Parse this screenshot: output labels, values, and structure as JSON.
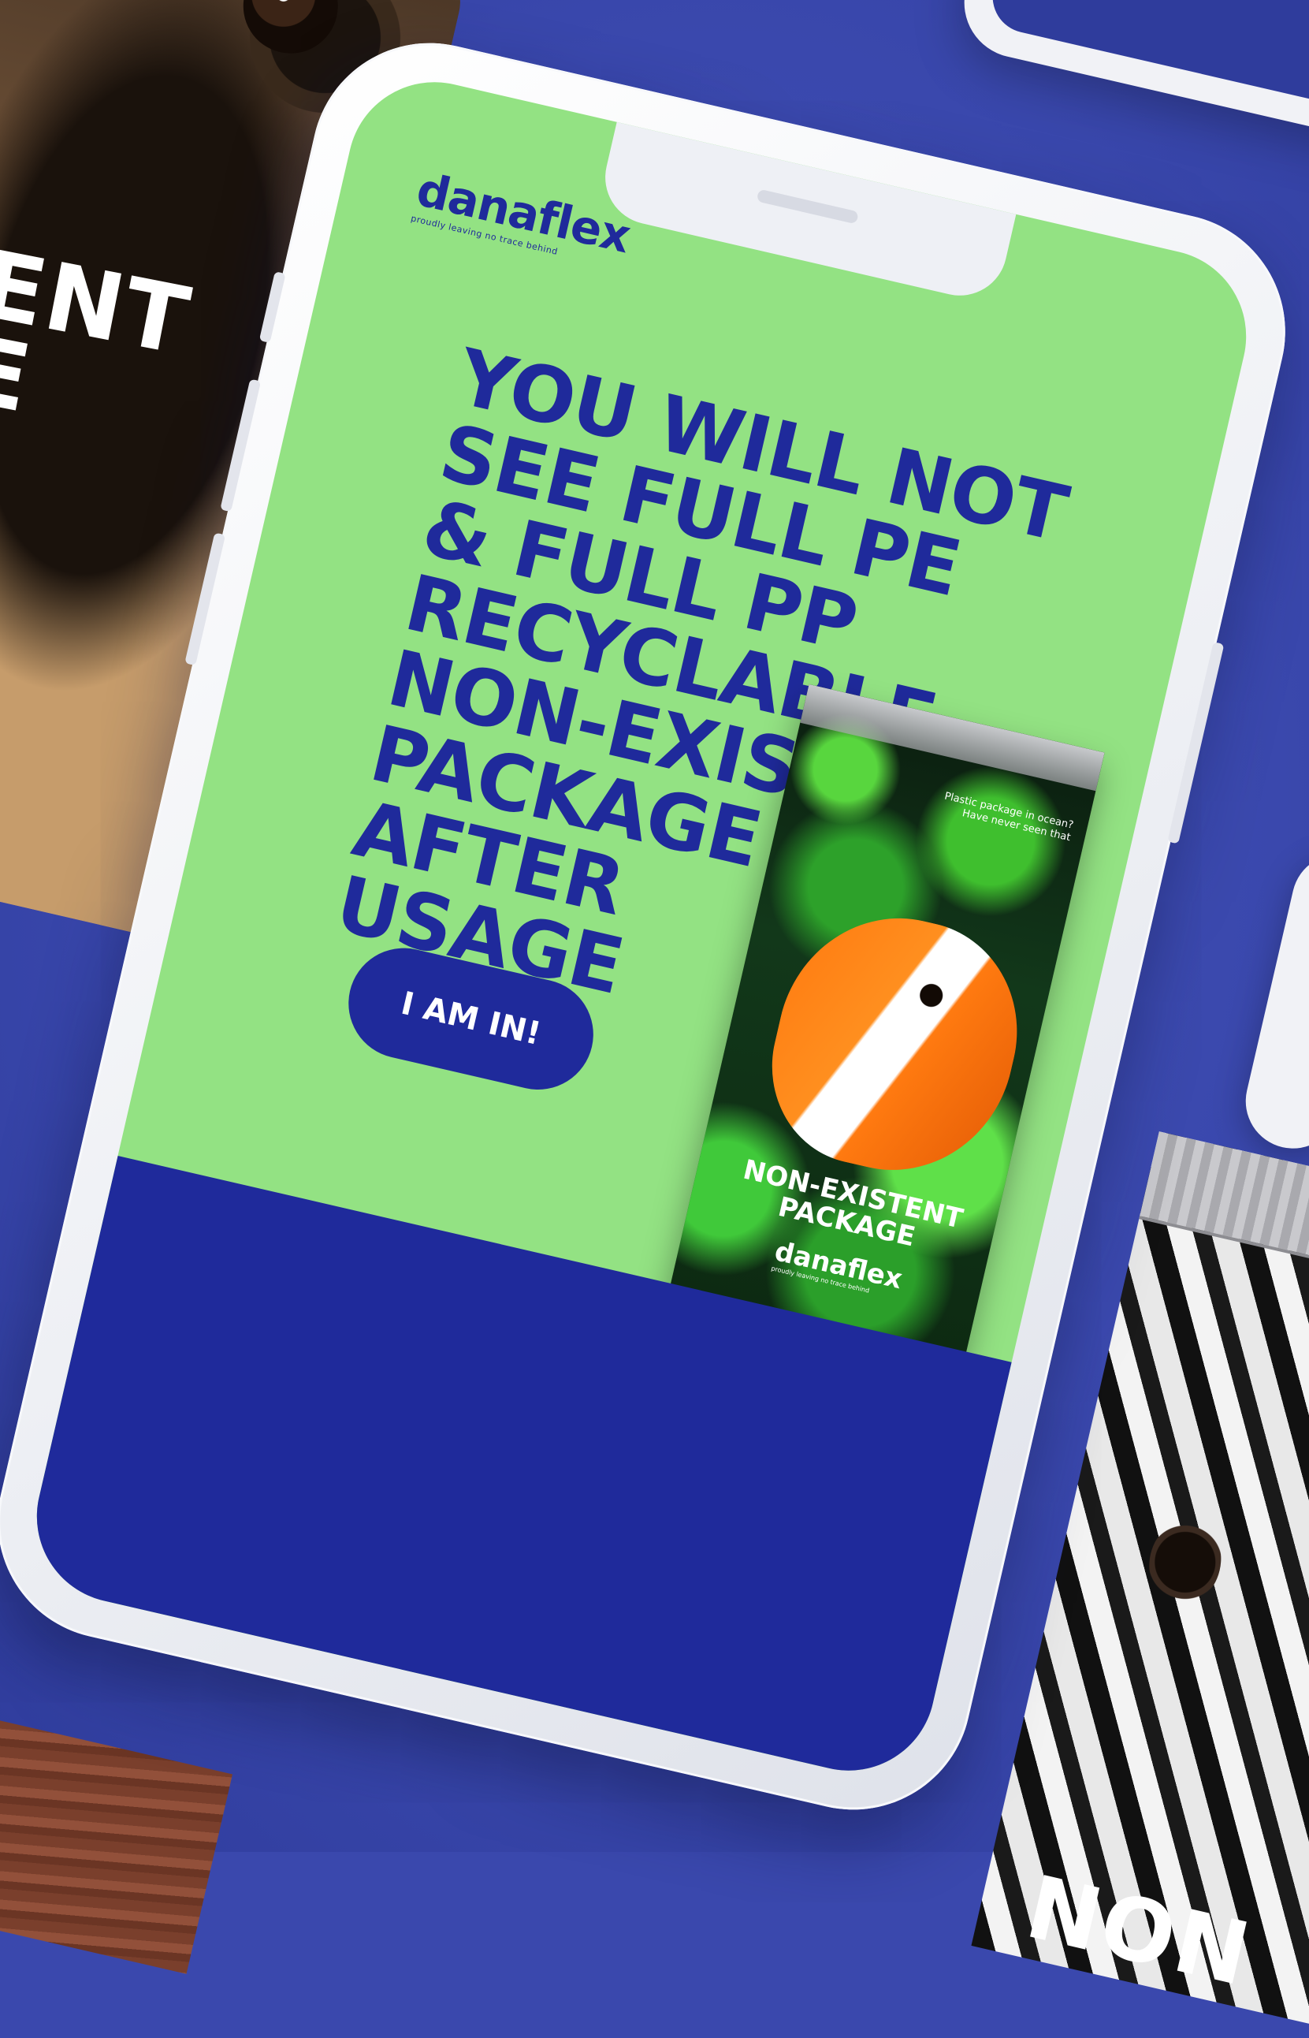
{
  "pug_card": {
    "text_lines": [
      "ENT",
      "E"
    ]
  },
  "zebra_pack": {
    "text": "NON"
  },
  "phone": {
    "logo": {
      "name": "danaflex",
      "tagline": "proudly leaving no trace behind"
    },
    "headline": {
      "lines": [
        "YOU WILL NOT",
        "SEE FULL PE",
        "& FULL PP",
        "RECYCLABLE",
        "NON-EXISTENT",
        "PACKAGE",
        "AFTER",
        "USAGE"
      ]
    },
    "cta_label": "I AM IN!",
    "poster": {
      "caption": "Plastic package in ocean? Have never seen that",
      "title_line1": "NON-EXISTENT",
      "title_line2": "PACKAGE",
      "logo_name": "danaflex",
      "logo_tagline": "proudly leaving no trace behind"
    }
  },
  "colors": {
    "background": "#3a48ad",
    "screen_green": "#93e283",
    "brand_blue": "#1f2a9b",
    "phone_frame": "#f1f2f6"
  }
}
